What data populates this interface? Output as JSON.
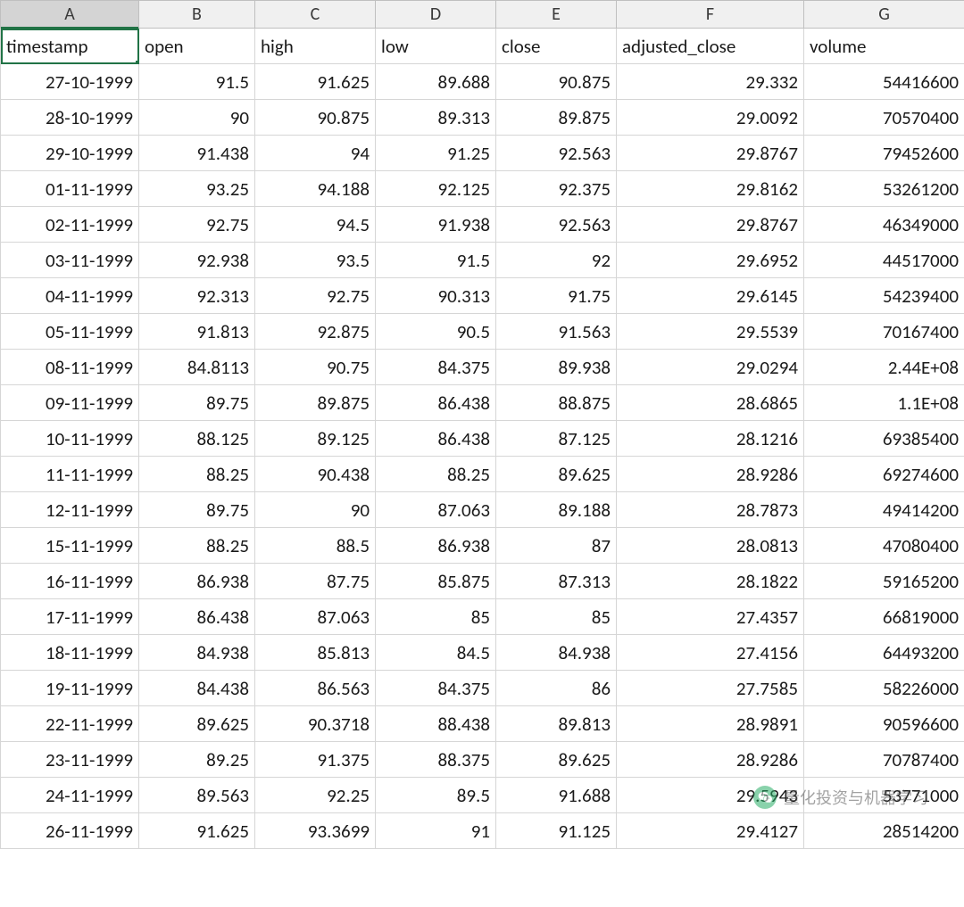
{
  "columns": [
    "A",
    "B",
    "C",
    "D",
    "E",
    "F",
    "G"
  ],
  "selectedColumn": "A",
  "activeCell": {
    "row": 0,
    "col": 0
  },
  "headers": [
    "timestamp",
    "open",
    "high",
    "low",
    "close",
    "adjusted_close",
    "volume"
  ],
  "rows": [
    [
      "27-10-1999",
      "91.5",
      "91.625",
      "89.688",
      "90.875",
      "29.332",
      "54416600"
    ],
    [
      "28-10-1999",
      "90",
      "90.875",
      "89.313",
      "89.875",
      "29.0092",
      "70570400"
    ],
    [
      "29-10-1999",
      "91.438",
      "94",
      "91.25",
      "92.563",
      "29.8767",
      "79452600"
    ],
    [
      "01-11-1999",
      "93.25",
      "94.188",
      "92.125",
      "92.375",
      "29.8162",
      "53261200"
    ],
    [
      "02-11-1999",
      "92.75",
      "94.5",
      "91.938",
      "92.563",
      "29.8767",
      "46349000"
    ],
    [
      "03-11-1999",
      "92.938",
      "93.5",
      "91.5",
      "92",
      "29.6952",
      "44517000"
    ],
    [
      "04-11-1999",
      "92.313",
      "92.75",
      "90.313",
      "91.75",
      "29.6145",
      "54239400"
    ],
    [
      "05-11-1999",
      "91.813",
      "92.875",
      "90.5",
      "91.563",
      "29.5539",
      "70167400"
    ],
    [
      "08-11-1999",
      "84.8113",
      "90.75",
      "84.375",
      "89.938",
      "29.0294",
      "2.44E+08"
    ],
    [
      "09-11-1999",
      "89.75",
      "89.875",
      "86.438",
      "88.875",
      "28.6865",
      "1.1E+08"
    ],
    [
      "10-11-1999",
      "88.125",
      "89.125",
      "86.438",
      "87.125",
      "28.1216",
      "69385400"
    ],
    [
      "11-11-1999",
      "88.25",
      "90.438",
      "88.25",
      "89.625",
      "28.9286",
      "69274600"
    ],
    [
      "12-11-1999",
      "89.75",
      "90",
      "87.063",
      "89.188",
      "28.7873",
      "49414200"
    ],
    [
      "15-11-1999",
      "88.25",
      "88.5",
      "86.938",
      "87",
      "28.0813",
      "47080400"
    ],
    [
      "16-11-1999",
      "86.938",
      "87.75",
      "85.875",
      "87.313",
      "28.1822",
      "59165200"
    ],
    [
      "17-11-1999",
      "86.438",
      "87.063",
      "85",
      "85",
      "27.4357",
      "66819000"
    ],
    [
      "18-11-1999",
      "84.938",
      "85.813",
      "84.5",
      "84.938",
      "27.4156",
      "64493200"
    ],
    [
      "19-11-1999",
      "84.438",
      "86.563",
      "84.375",
      "86",
      "27.7585",
      "58226000"
    ],
    [
      "22-11-1999",
      "89.625",
      "90.3718",
      "88.438",
      "89.813",
      "28.9891",
      "90596600"
    ],
    [
      "23-11-1999",
      "89.25",
      "91.375",
      "88.375",
      "89.625",
      "28.9286",
      "70787400"
    ],
    [
      "24-11-1999",
      "89.563",
      "92.25",
      "89.5",
      "91.688",
      "29.5943",
      "53771000"
    ],
    [
      "26-11-1999",
      "91.625",
      "93.3699",
      "91",
      "91.125",
      "29.4127",
      "28514200"
    ]
  ],
  "watermark": {
    "text": "量化投资与机器学习",
    "icon": "wechat-icon"
  }
}
